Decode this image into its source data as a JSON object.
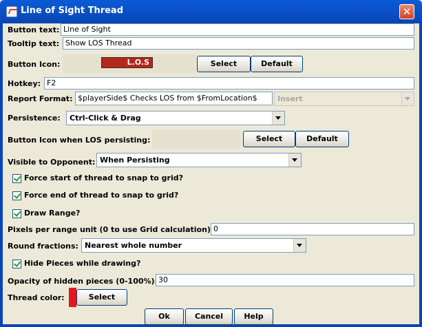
{
  "window": {
    "title": "Line of Sight Thread",
    "close_glyph": "✕"
  },
  "button_text": {
    "label": "Button text:",
    "value": "Line of Sight"
  },
  "tooltip_text": {
    "label": "Tooltip text:",
    "value": "Show LOS Thread"
  },
  "button_icon": {
    "label": "Button Icon:",
    "icon_text": "L.O.S",
    "select_label": "Select",
    "default_label": "Default"
  },
  "hotkey": {
    "label": "Hotkey:",
    "value": "F2"
  },
  "report_format": {
    "label": "Report Format:",
    "value": "$playerSide$ Checks LOS from $FromLocation$",
    "insert_label": "Insert"
  },
  "persistence": {
    "label": "Persistence:",
    "value": "Ctrl-Click & Drag"
  },
  "persist_icon": {
    "label": "Button Icon when LOS persisting:",
    "select_label": "Select",
    "default_label": "Default"
  },
  "visible_to_opponent": {
    "label": "Visible to Opponent:",
    "value": "When Persisting"
  },
  "checkboxes": {
    "snap_start": "Force start of thread to snap to grid?",
    "snap_end": "Force end of thread to snap to grid?",
    "draw_range": "Draw Range?",
    "hide_pieces": "Hide Pieces while drawing?"
  },
  "pixels_per_range": {
    "label": "Pixels per range unit (0 to use Grid calculation):",
    "value": "0"
  },
  "round_fractions": {
    "label": "Round fractions:",
    "value": "Nearest whole number"
  },
  "opacity": {
    "label": "Opacity of hidden pieces (0-100%):",
    "value": "30"
  },
  "thread_color": {
    "label": "Thread color:",
    "select_label": "Select",
    "color": "#e4161b"
  },
  "footer": {
    "ok": "Ok",
    "cancel": "Cancel",
    "help": "Help"
  }
}
